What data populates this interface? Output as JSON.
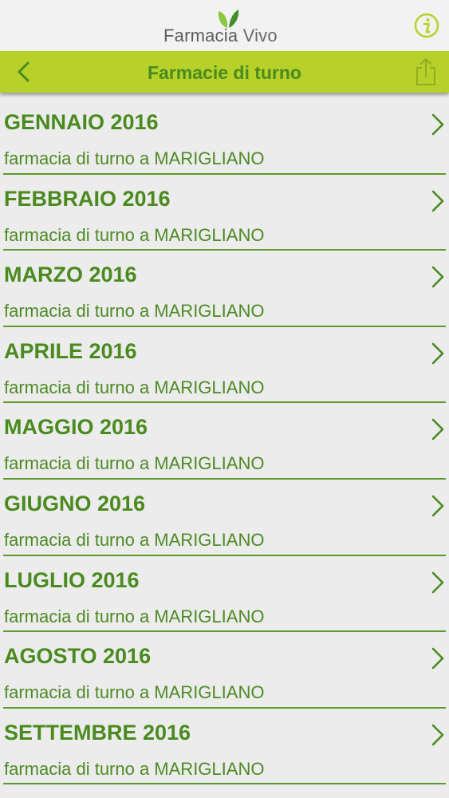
{
  "app": {
    "logo_word1": "Farmacia",
    "logo_word2": "Vivo"
  },
  "icons": {
    "info": "info-icon",
    "back": "chevron-left-icon",
    "share": "share-icon",
    "row_arrow": "chevron-right-icon",
    "logo": "leaf-logo-icon"
  },
  "colors": {
    "navbar": "#b7d12a",
    "accent_green": "#4a8a1f",
    "background": "#ececec"
  },
  "navbar": {
    "title": "Farmacie di turno"
  },
  "items": [
    {
      "month": "GENNAIO 2016",
      "subtitle": "farmacia di turno a MARIGLIANO"
    },
    {
      "month": "FEBBRAIO 2016",
      "subtitle": "farmacia di turno a MARIGLIANO"
    },
    {
      "month": "MARZO 2016",
      "subtitle": "farmacia di turno a MARIGLIANO"
    },
    {
      "month": "APRILE 2016",
      "subtitle": "farmacia di turno a MARIGLIANO"
    },
    {
      "month": "MAGGIO 2016",
      "subtitle": "farmacia di turno a MARIGLIANO"
    },
    {
      "month": "GIUGNO 2016",
      "subtitle": "farmacia di turno a MARIGLIANO"
    },
    {
      "month": "LUGLIO 2016",
      "subtitle": "farmacia di turno a MARIGLIANO"
    },
    {
      "month": "AGOSTO 2016",
      "subtitle": "farmacia di turno a MARIGLIANO"
    },
    {
      "month": "SETTEMBRE 2016",
      "subtitle": "farmacia di turno a MARIGLIANO"
    }
  ]
}
